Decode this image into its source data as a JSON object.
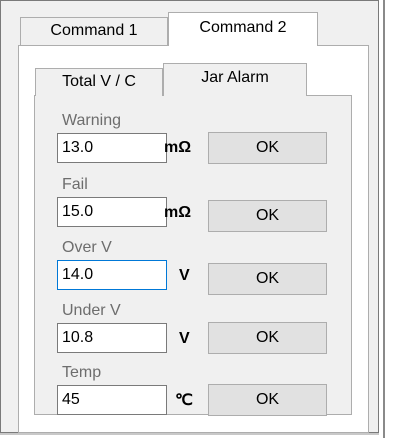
{
  "tabs": {
    "command1_label": "Command 1",
    "command2_label": "Command 2",
    "active": "Command 2"
  },
  "subtabs": {
    "total_label": "Total V / C",
    "jar_alarm_label": "Jar Alarm",
    "active": "Jar Alarm"
  },
  "fields": [
    {
      "label": "Warning",
      "value": "13.0",
      "unit": "mΩ",
      "button": "OK"
    },
    {
      "label": "Fail",
      "value": "15.0",
      "unit": "mΩ",
      "button": "OK"
    },
    {
      "label": "Over V",
      "value": "14.0",
      "unit": "V",
      "button": "OK"
    },
    {
      "label": "Under V",
      "value": "10.8",
      "unit": "V",
      "button": "OK"
    },
    {
      "label": "Temp",
      "value": "45",
      "unit": "℃",
      "button": "OK"
    }
  ]
}
